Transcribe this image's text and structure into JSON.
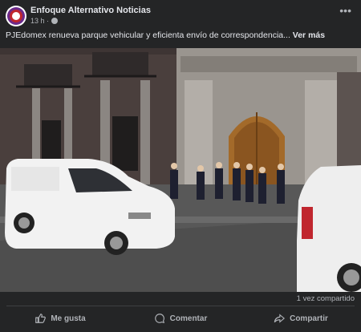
{
  "post": {
    "page_name": "Enfoque Alternativo Noticias",
    "time": "13 h ·",
    "caption_text": "PJEdomex renueva parque vehicular y eficienta envío de correspondencia... ",
    "see_more": "Ver más"
  },
  "stats": {
    "shares": "1 vez compartido"
  },
  "actions": {
    "like": "Me gusta",
    "comment": "Comentar",
    "share": "Compartir"
  },
  "colors": {
    "background": "#242526",
    "text": "#e4e6eb",
    "muted": "#b0b3b8"
  },
  "icons": [
    "more-options-icon",
    "globe-icon",
    "like-icon",
    "comment-icon",
    "share-icon"
  ]
}
